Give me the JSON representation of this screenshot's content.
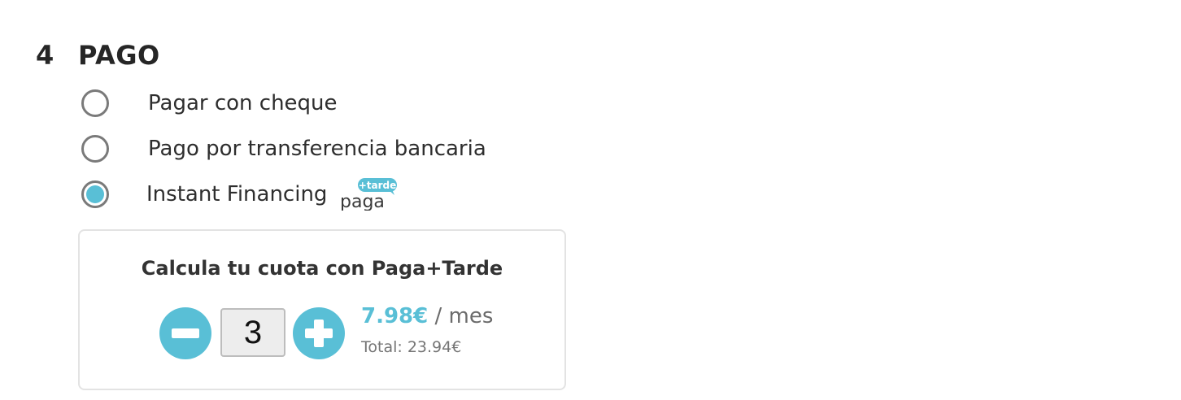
{
  "payment": {
    "step_number": "4",
    "title": "PAGO",
    "options": [
      {
        "label": "Pagar con cheque",
        "selected": false
      },
      {
        "label": "Pago por transferencia bancaria",
        "selected": false
      },
      {
        "label": "Instant Financing",
        "selected": true
      }
    ],
    "logo": {
      "text": "paga",
      "badge": "+tarde"
    }
  },
  "calculator": {
    "title": "Calcula tu cuota con Paga+Tarde",
    "quantity": "3",
    "monthly_amount": "7.98€",
    "monthly_unit": " / mes",
    "total": "Total: 23.94€"
  },
  "colors": {
    "accent": "#59bfd6",
    "radio_border": "#7a7a7a",
    "box_border": "#e3e3e3"
  },
  "icons": {
    "minus": "minus-icon",
    "plus": "plus-icon"
  }
}
